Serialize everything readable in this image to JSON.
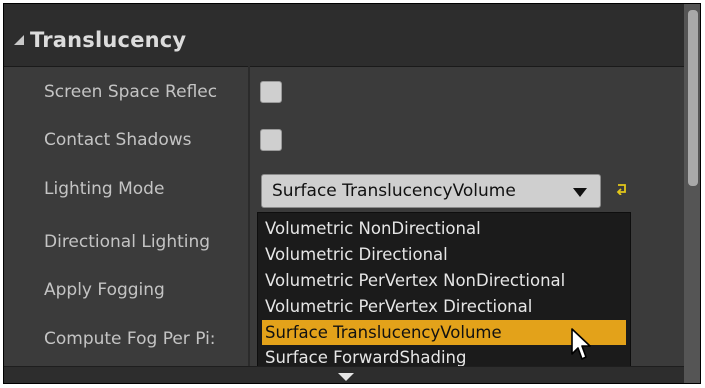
{
  "section": {
    "title": "Translucency"
  },
  "rows": {
    "screen_space_reflections": "Screen Space Reflec",
    "contact_shadows": "Contact Shadows",
    "lighting_mode": "Lighting Mode",
    "directional_lighting": "Directional Lighting",
    "apply_fogging": "Apply Fogging",
    "compute_fog_per_pixel": "Compute Fog Per Pi:"
  },
  "lighting_mode_combo": {
    "value": "Surface TranslucencyVolume"
  },
  "dropdown": {
    "options": [
      "Volumetric NonDirectional",
      "Volumetric Directional",
      "Volumetric PerVertex NonDirectional",
      "Volumetric PerVertex Directional",
      "Surface TranslucencyVolume",
      "Surface ForwardShading"
    ],
    "selected": "Surface TranslucencyVolume"
  },
  "colors": {
    "panel_background": "#3b3b3b",
    "header_background": "#2d2d2d",
    "dropdown_background": "#1b1b1b",
    "highlight": "#e3a21a",
    "reset_arrow": "#e3c71a"
  },
  "icons": {
    "collapse": "triangle-collapse-icon",
    "combo_caret": "caret-down-icon",
    "reset_to_default": "reset-arrow-icon",
    "footer_expand": "triangle-down-icon",
    "cursor": "mouse-pointer-icon"
  }
}
